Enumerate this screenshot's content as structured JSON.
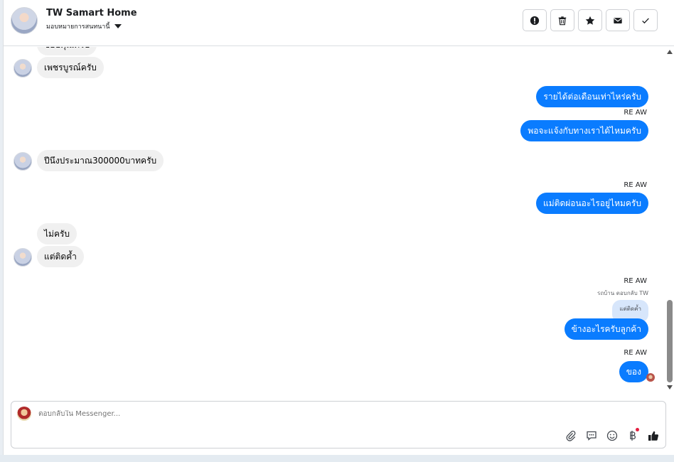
{
  "header": {
    "name": "TW Samart Home",
    "assign_label": "มอบหมายการสนทนานี้"
  },
  "toolbar": {
    "items": [
      {
        "icon": "alert-icon"
      },
      {
        "icon": "trash-icon"
      },
      {
        "icon": "star-icon"
      },
      {
        "icon": "mail-icon"
      },
      {
        "icon": "check-icon"
      }
    ]
  },
  "messages": {
    "cut_top": "ขอบคุณครับ",
    "m1": "เพชรบูรณ์ครับ",
    "m2": "รายได้ต่อเดือนเท่าไหร่ครับ",
    "m2_sender": "RE AW",
    "m3": "พอจะแจ้งกับทางเราได้ไหมครับ",
    "m4": "ปีนึงประมาณ300000บาทครับ",
    "m5_sender": "RE AW",
    "m5": "แม่ติดผ่อนอะไรอยู่ไหมครับ",
    "m6": "ไม่ครับ",
    "m7": "แต่ติดค้ำ",
    "m8_sender": "RE AW",
    "m8_reply_note": "รถบ้าน ตอบกลับ TW",
    "m8_quoted": "แต่ติดค้ำ",
    "m8": "ข้างอะไรครับลูกค้า",
    "m9_sender": "RE AW",
    "m9": "ของ"
  },
  "composer": {
    "placeholder": "ตอบกลับใน Messenger...",
    "tools": [
      "paperclip-icon",
      "chat-icon",
      "emoji-icon",
      "baht-icon",
      "like-icon"
    ]
  },
  "colors": {
    "outgoing_bubble": "#0a7cff",
    "incoming_bubble": "#f0f0f0",
    "quoted_bubble": "#d7e6fb"
  }
}
